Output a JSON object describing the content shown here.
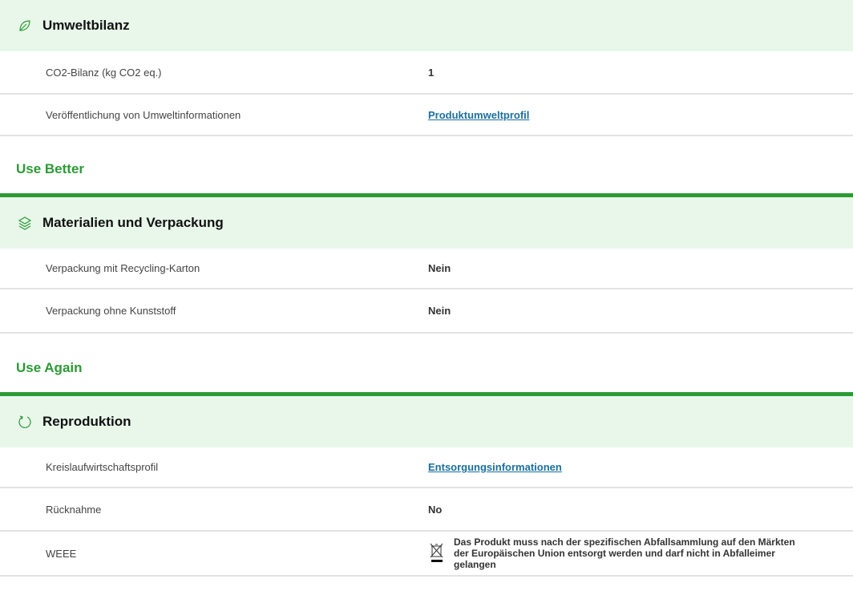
{
  "env": {
    "title": "Umweltbilanz",
    "rows": [
      {
        "label": "CO2-Bilanz (kg CO2 eq.)",
        "value": "1"
      },
      {
        "label": "Veröffentlichung von Umweltinformationen",
        "value": "Produktumweltprofil"
      }
    ]
  },
  "use_better": {
    "heading": "Use Better",
    "section_title": "Materialien und Verpackung",
    "rows": [
      {
        "label": "Verpackung mit Recycling-Karton",
        "value": "Nein"
      },
      {
        "label": "Verpackung ohne Kunststoff",
        "value": "Nein"
      }
    ]
  },
  "use_again": {
    "heading": "Use Again",
    "section_title": "Reproduktion",
    "rows": [
      {
        "label": "Kreislaufwirtschaftsprofil",
        "value": "Entsorgungsinformationen"
      },
      {
        "label": "Rücknahme",
        "value": "No"
      },
      {
        "label": "WEEE",
        "value": "Das Produkt muss nach der spezifischen Abfallsammlung auf den Märkten der Europäischen Union entsorgt werden und darf nicht in Abfalleimer gelangen"
      }
    ]
  },
  "icons": {
    "env": "leaf-icon",
    "materials": "layers-icon",
    "reproduction": "circular-arrow-icon",
    "weee": "crossed-out-bin-icon"
  },
  "colors": {
    "accent": "#2c9a35",
    "header_bg": "#e8f7ea",
    "link": "#1a6f9e"
  }
}
